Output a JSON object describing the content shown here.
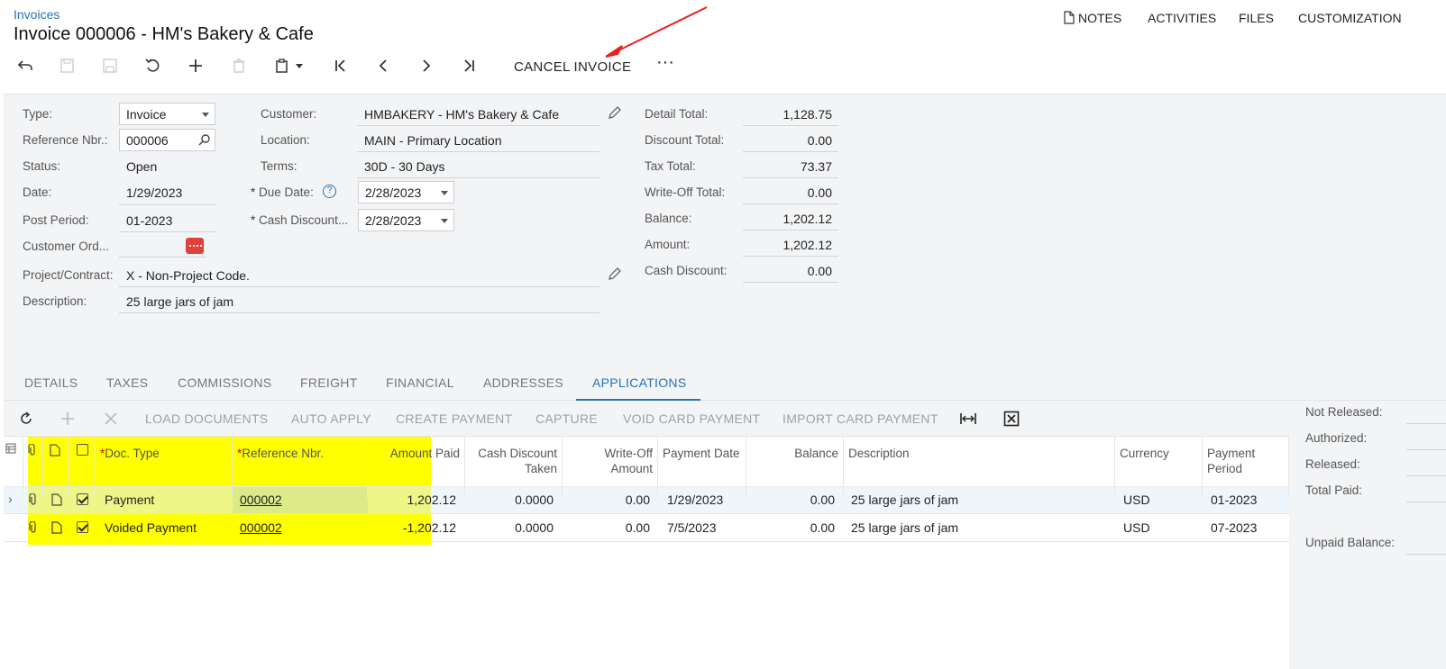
{
  "header": {
    "breadcrumb": "Invoices",
    "title": "Invoice 000006 - HM's Bakery & Cafe",
    "nav": [
      "NOTES",
      "ACTIVITIES",
      "FILES",
      "CUSTOMIZATION"
    ],
    "cancel_label": "CANCEL INVOICE",
    "more_label": "···"
  },
  "form": {
    "type_label": "Type:",
    "type_value": "Invoice",
    "refnbr_label": "Reference Nbr.:",
    "refnbr_value": "000006",
    "status_label": "Status:",
    "status_value": "Open",
    "date_label": "Date:",
    "date_value": "1/29/2023",
    "postperiod_label": "Post Period:",
    "postperiod_value": "01-2023",
    "custorder_label": "Customer Ord...",
    "project_label": "Project/Contract:",
    "project_value": "X - Non-Project Code.",
    "description_label": "Description:",
    "description_value": "25 large jars of jam",
    "customer_label": "Customer:",
    "customer_value": "HMBAKERY - HM's Bakery & Cafe",
    "location_label": "Location:",
    "location_value": "MAIN - Primary Location",
    "terms_label": "Terms:",
    "terms_value": "30D - 30 Days",
    "duedate_label": "Due Date:",
    "duedate_value": "2/28/2023",
    "cashdisc_label": "Cash Discount...",
    "cashdisc_value": "2/28/2023",
    "required_mark": "*"
  },
  "totals": [
    {
      "label": "Detail Total:",
      "value": "1,128.75"
    },
    {
      "label": "Discount Total:",
      "value": "0.00"
    },
    {
      "label": "Tax Total:",
      "value": "73.37"
    },
    {
      "label": "Write-Off Total:",
      "value": "0.00"
    },
    {
      "label": "Balance:",
      "value": "1,202.12"
    },
    {
      "label": "Amount:",
      "value": "1,202.12"
    },
    {
      "label": "Cash Discount:",
      "value": "0.00"
    }
  ],
  "tabs": [
    "DETAILS",
    "TAXES",
    "COMMISSIONS",
    "FREIGHT",
    "FINANCIAL",
    "ADDRESSES",
    "APPLICATIONS"
  ],
  "grid_toolbar": [
    "LOAD DOCUMENTS",
    "AUTO APPLY",
    "CREATE PAYMENT",
    "CAPTURE",
    "VOID CARD PAYMENT",
    "IMPORT CARD PAYMENT"
  ],
  "grid": {
    "headers": {
      "doc_type": "Doc. Type",
      "ref_nbr": "Reference Nbr.",
      "amount_paid": "Amount Paid",
      "cash_discount": "Cash Discount Taken",
      "write_off": "Write-Off Amount",
      "payment_date": "Payment Date",
      "balance": "Balance",
      "description": "Description",
      "currency": "Currency",
      "payment_period": "Payment Period"
    },
    "rows": [
      {
        "doc_type": "Payment",
        "ref_nbr": "000002",
        "amount_paid": "1,202.12",
        "cash_discount": "0.0000",
        "write_off": "0.00",
        "payment_date": "1/29/2023",
        "balance": "0.00",
        "description": "25 large jars of jam",
        "currency": "USD",
        "payment_period": "01-2023"
      },
      {
        "doc_type": "Voided Payment",
        "ref_nbr": "000002",
        "amount_paid": "-1,202.12",
        "cash_discount": "0.0000",
        "write_off": "0.00",
        "payment_date": "7/5/2023",
        "balance": "0.00",
        "description": "25 large jars of jam",
        "currency": "USD",
        "payment_period": "07-2023"
      }
    ]
  },
  "side_panel": [
    "Not Released:",
    "Authorized:",
    "Released:",
    "Total Paid:",
    "Unpaid Balance:"
  ],
  "colors": {
    "accent": "#2672b8",
    "highlight": "#ffff00",
    "arrow": "#e8221b",
    "form_bg": "#f3f4f6"
  },
  "icons": [
    "back-icon",
    "save-close-icon",
    "save-icon",
    "undo-icon",
    "add-icon",
    "delete-icon",
    "clipboard-icon",
    "first-record-icon",
    "prev-record-icon",
    "next-record-icon",
    "last-record-icon",
    "note-icon",
    "refresh-icon",
    "fit-columns-icon",
    "excel-export-icon",
    "pencil-icon",
    "search-icon",
    "help-icon",
    "red-arrow-annotation"
  ]
}
